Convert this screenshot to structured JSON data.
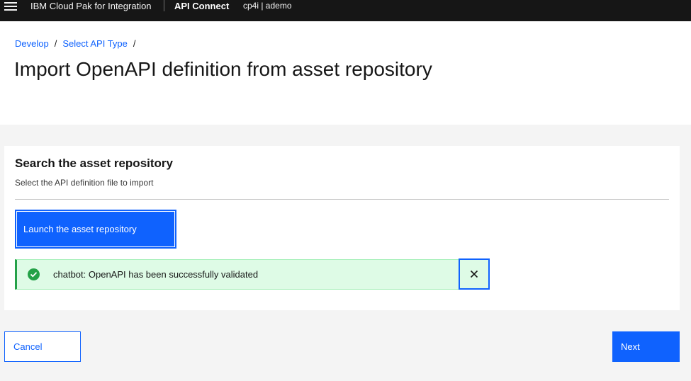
{
  "topbar": {
    "menu_icon": "hamburger-menu-icon",
    "brand": "IBM Cloud Pak for Integration",
    "product": "API Connect",
    "instance": "cp4i | ademo"
  },
  "breadcrumb": {
    "items": [
      "Develop",
      "Select API Type"
    ],
    "separator": "/"
  },
  "page": {
    "title": "Import OpenAPI definition from asset repository"
  },
  "card": {
    "title": "Search the asset repository",
    "subtitle": "Select the API definition file to import",
    "launch_button": "Launch the asset repository"
  },
  "notification": {
    "type": "success",
    "icon": "checkmark-filled-icon",
    "message": "chatbot: OpenAPI has been successfully validated",
    "close_icon": "close-icon"
  },
  "footer": {
    "cancel_label": "Cancel",
    "next_label": "Next"
  },
  "colors": {
    "accent": "#0f62fe",
    "success": "#24a148",
    "success_bg": "#defbe6",
    "topbar": "#161616",
    "background": "#f4f4f4"
  }
}
